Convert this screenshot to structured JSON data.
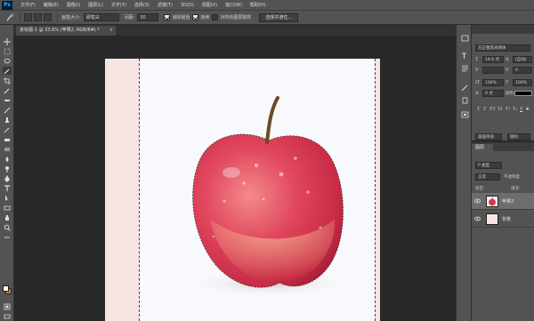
{
  "app": {
    "logo": "Ps"
  },
  "menu": [
    "文件(F)",
    "编辑(E)",
    "图像(I)",
    "图层(L)",
    "文字(Y)",
    "选择(S)",
    "滤镜(T)",
    "3D(D)",
    "视图(V)",
    "窗口(W)",
    "帮助(H)"
  ],
  "options": {
    "brush_size_label": "画笔大小:",
    "brush_size_value": "硬笔尖",
    "spacing_label": "间距:",
    "spacing_value": "30",
    "check1_label": "消除锯齿",
    "check2_label": "连续",
    "check3_label": "对所有图层取样",
    "refine_button": "选择并遮住..."
  },
  "document": {
    "tab_title": "未标题-1 @ 33.6% (苹果2, RGB/8#) *",
    "tab_close": "×"
  },
  "character": {
    "font_family": "方正粗黑宋简体",
    "font_size": "14.6 点",
    "leading": "(自动)",
    "tracking": "0",
    "vscale": "100%",
    "hscale": "100%",
    "baseline": "0 点",
    "color_label": "颜色:",
    "styles": [
      "T",
      "T",
      "TT",
      "Tt",
      "T¹",
      "T₁",
      "T",
      "T"
    ],
    "lang": "美国英语",
    "aa": "锐利"
  },
  "layers": {
    "tab": "图层",
    "filter_label": "P 类型",
    "mode": "正常",
    "opacity": "不透明度:",
    "lock": "锁定:",
    "fill": "填充:",
    "items": [
      {
        "name": "苹果2"
      },
      {
        "name": "背景"
      }
    ]
  },
  "colors": {
    "canvas_bg": "#f6e5e2",
    "foreground": "#ffffff",
    "background": "#c08040"
  }
}
